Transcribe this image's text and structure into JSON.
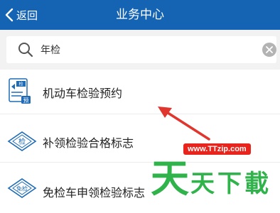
{
  "nav": {
    "back_label": "返回",
    "title": "业务中心"
  },
  "search": {
    "value": "年检",
    "placeholder": ""
  },
  "items": [
    {
      "label": "机动车检验预约",
      "icon": "document-appointment-icon",
      "icon_text_top": "检",
      "icon_text_badge": "预"
    },
    {
      "label": "补领检验合格标志",
      "icon": "inspection-diamond-icon",
      "icon_text": "检"
    },
    {
      "label": "免检车申领检验标志",
      "icon": "exempt-diamond-icon",
      "icon_text": "免检"
    }
  ],
  "watermark": {
    "url": "www.TTzip.com",
    "logo_text": "天天下载"
  },
  "colors": {
    "nav_bg": "#1564b4",
    "icon_blue": "#1f6bb5",
    "arrow_red": "#e0362d",
    "watermark_green": "#2fb34a",
    "watermark_red": "#e8241c"
  }
}
